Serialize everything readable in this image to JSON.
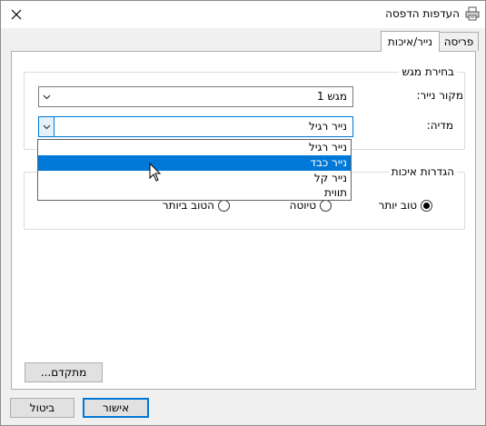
{
  "window": {
    "title": "העדפות הדפסה"
  },
  "tabs": [
    {
      "label": "פריסה",
      "active": false
    },
    {
      "label": "נייר/איכות",
      "active": true
    }
  ],
  "tray_group": {
    "title": "בחירת מגש",
    "paper_source_label": "מקור נייר:",
    "paper_source_value": "מגש 1",
    "media_label": "מדיה:",
    "media_value": "נייר רגיל"
  },
  "media_dropdown": {
    "options": [
      "נייר רגיל",
      "נייר כבד",
      "נייר קל",
      "תווית"
    ],
    "highlighted_index": 1
  },
  "quality_group": {
    "title": "הגדרות איכות",
    "options": [
      {
        "label": "טוב יותר",
        "checked": true
      },
      {
        "label": "טיוטה",
        "checked": false
      },
      {
        "label": "הטוב ביותר",
        "checked": false
      }
    ]
  },
  "buttons": {
    "advanced": "מתקדם...",
    "ok": "אישור",
    "cancel": "ביטול"
  },
  "colors": {
    "accent": "#0078d7",
    "window_bg": "#f0f0f0",
    "panel_bg": "#ffffff"
  }
}
